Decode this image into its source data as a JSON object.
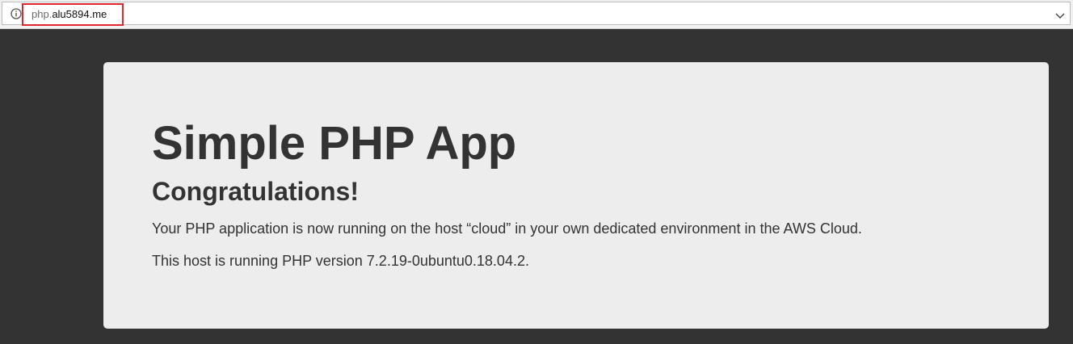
{
  "browser": {
    "url_subdomain": "php.",
    "url_domain": "alu5894.me",
    "info_icon": "info-icon",
    "dropdown_icon": "chevron-down-icon",
    "highlight_color": "#e3262e"
  },
  "page": {
    "title": "Simple PHP App",
    "subtitle": "Congratulations!",
    "paragraph_1": "Your PHP application is now running on the host “cloud” in your own dedicated environment in the AWS Cloud.",
    "paragraph_2": "This host is running PHP version 7.2.19-0ubuntu0.18.04.2."
  },
  "colors": {
    "background": "#333333",
    "panel": "#ededed",
    "text": "#333333"
  }
}
